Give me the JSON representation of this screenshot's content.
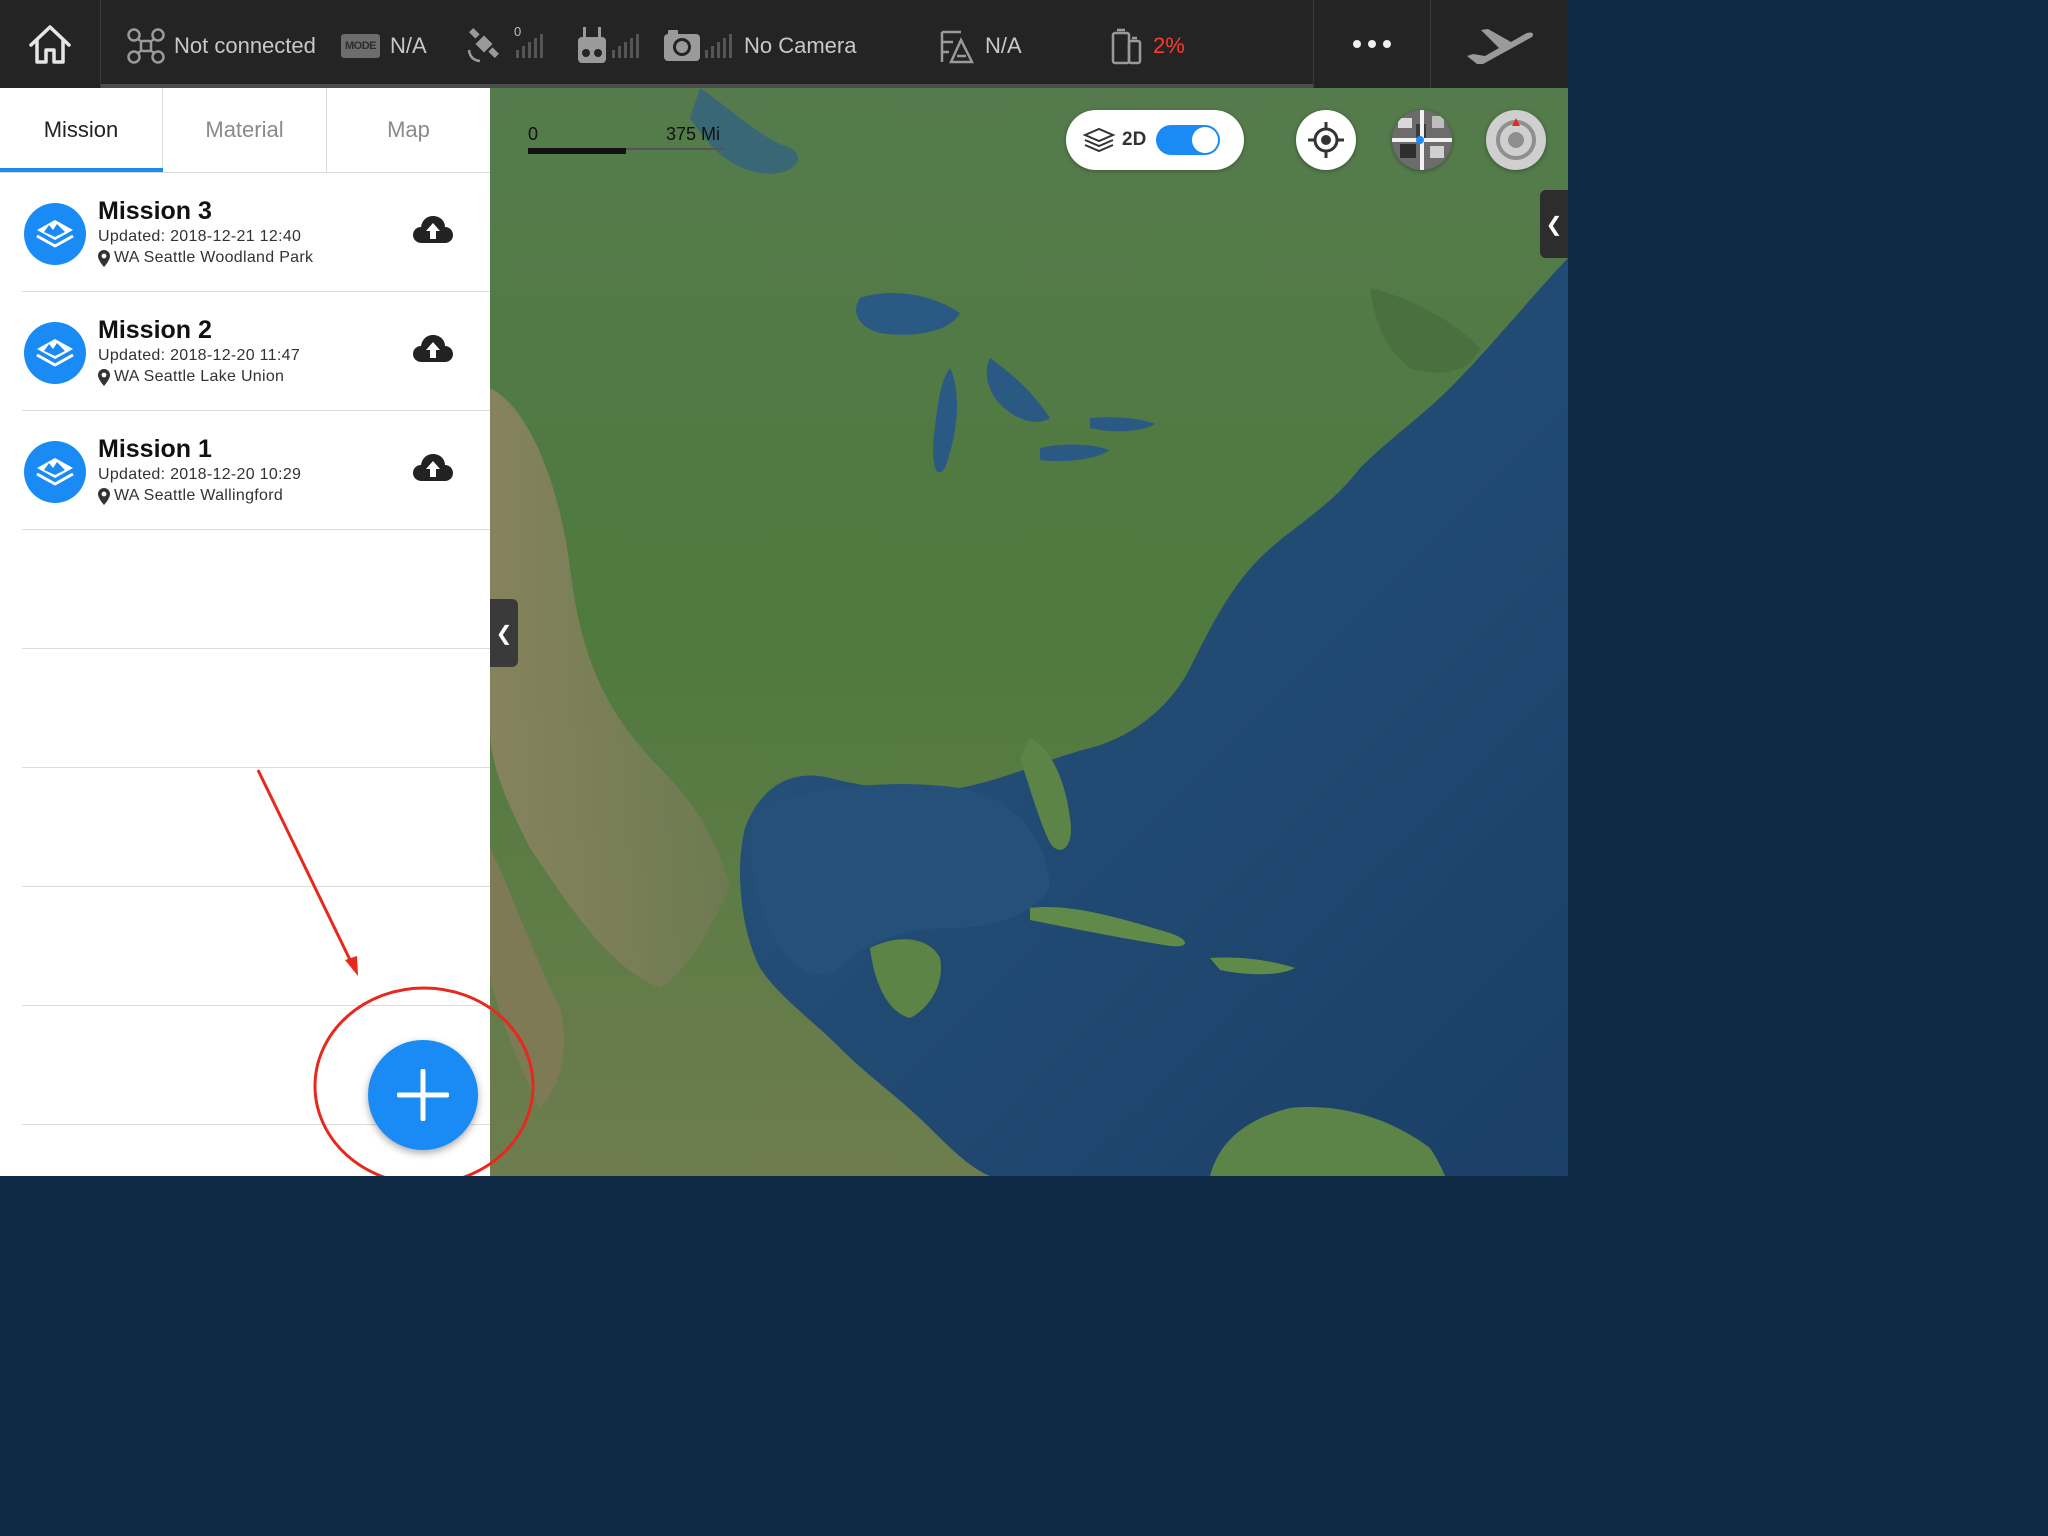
{
  "topbar": {
    "aircraft_status": "Not connected",
    "mode_badge": "MODE",
    "mode_value": "N/A",
    "satellite_count": "0",
    "camera_status": "No Camera",
    "flight_mode_value": "N/A",
    "battery_percent": "2%"
  },
  "tabs": [
    {
      "label": "Mission"
    },
    {
      "label": "Material"
    },
    {
      "label": "Map"
    }
  ],
  "missions": [
    {
      "title": "Mission 3",
      "updated": "Updated: 2018-12-21 12:40",
      "location": "WA Seattle Woodland Park"
    },
    {
      "title": "Mission 2",
      "updated": "Updated: 2018-12-20 11:47",
      "location": "WA Seattle Lake Union"
    },
    {
      "title": "Mission 1",
      "updated": "Updated: 2018-12-20 10:29",
      "location": "WA Seattle Wallingford"
    }
  ],
  "map": {
    "scale_start": "0",
    "scale_end": "375 Mi",
    "view_mode": "2D",
    "view_toggle_on": true
  },
  "colors": {
    "accent": "#1a8bf5",
    "topbar_bg": "#242424",
    "battery_warning": "#ff3b30",
    "annotation_red": "#e8281c"
  }
}
